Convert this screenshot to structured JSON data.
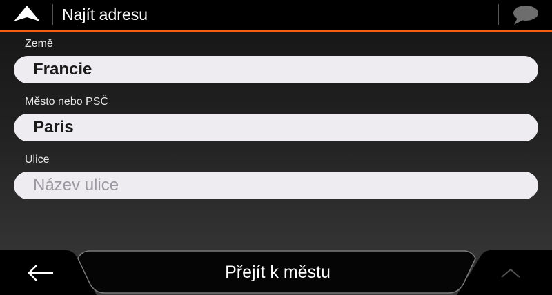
{
  "header": {
    "title": "Najít adresu",
    "logo_icon": "navigation-arrow-icon",
    "chat_icon": "speech-bubble-icon",
    "accent_color": "#f2600f"
  },
  "form": {
    "country": {
      "label": "Země",
      "value": "Francie"
    },
    "city": {
      "label": "Město nebo PSČ",
      "value": "Paris"
    },
    "street": {
      "label": "Ulice",
      "value": "",
      "placeholder": "Název ulice"
    }
  },
  "footer": {
    "back_icon": "back-arrow-icon",
    "go_button_label": "Přejít k městu",
    "up_icon": "chevron-up-icon"
  }
}
